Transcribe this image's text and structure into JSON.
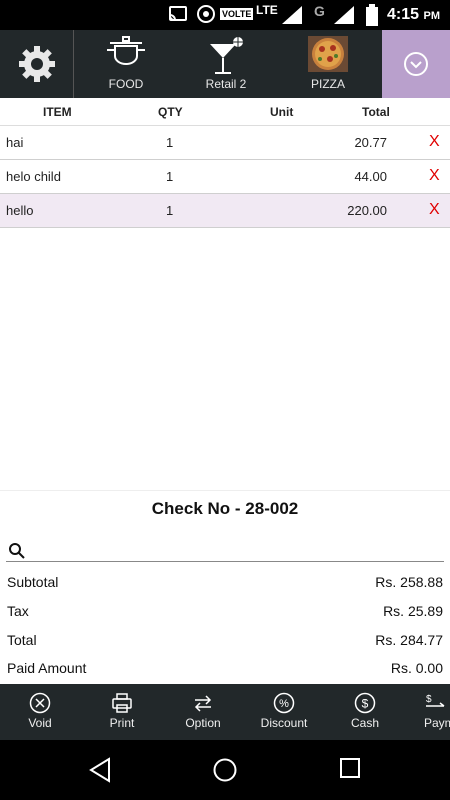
{
  "status_bar": {
    "time": "4:15",
    "ampm": "PM",
    "volte": "VOLTE",
    "lte": "LTE",
    "network": "G"
  },
  "categories": [
    {
      "label": "FOOD",
      "icon": "food-pot-icon"
    },
    {
      "label": "Retail 2",
      "icon": "cocktail-icon"
    },
    {
      "label": "PIZZA",
      "icon": "pizza-image"
    }
  ],
  "table": {
    "headers": {
      "item": "ITEM",
      "qty": "QTY",
      "unit": "Unit",
      "total": "Total"
    },
    "rows": [
      {
        "item": "hai",
        "qty": "1",
        "unit": "",
        "total": "20.77",
        "delete": "X"
      },
      {
        "item": "helo child",
        "qty": "1",
        "unit": "",
        "total": "44.00",
        "delete": "X"
      },
      {
        "item": "hello",
        "qty": "1",
        "unit": "",
        "total": "220.00",
        "delete": "X"
      }
    ]
  },
  "check": {
    "label": "Check No - ",
    "number": "28-002"
  },
  "search": {
    "placeholder": ""
  },
  "summary": {
    "subtotal_label": "Subtotal",
    "subtotal": "Rs. 258.88",
    "tax_label": "Tax",
    "tax": "Rs. 25.89",
    "total_label": "Total",
    "total": "Rs. 284.77",
    "paid_label": "Paid Amount",
    "paid": "Rs. 0.00"
  },
  "actions": [
    {
      "label": "Void",
      "icon": "void-icon"
    },
    {
      "label": "Print",
      "icon": "printer-icon"
    },
    {
      "label": "Option",
      "icon": "swap-icon"
    },
    {
      "label": "Discount",
      "icon": "percent-icon"
    },
    {
      "label": "Cash",
      "icon": "dollar-icon"
    },
    {
      "label": "Paym",
      "icon": "payment-icon"
    }
  ],
  "colors": {
    "bar": "#22282a",
    "accent": "#b9a0cc",
    "delete": "#e00000",
    "selected_row": "#f1e9f3"
  }
}
